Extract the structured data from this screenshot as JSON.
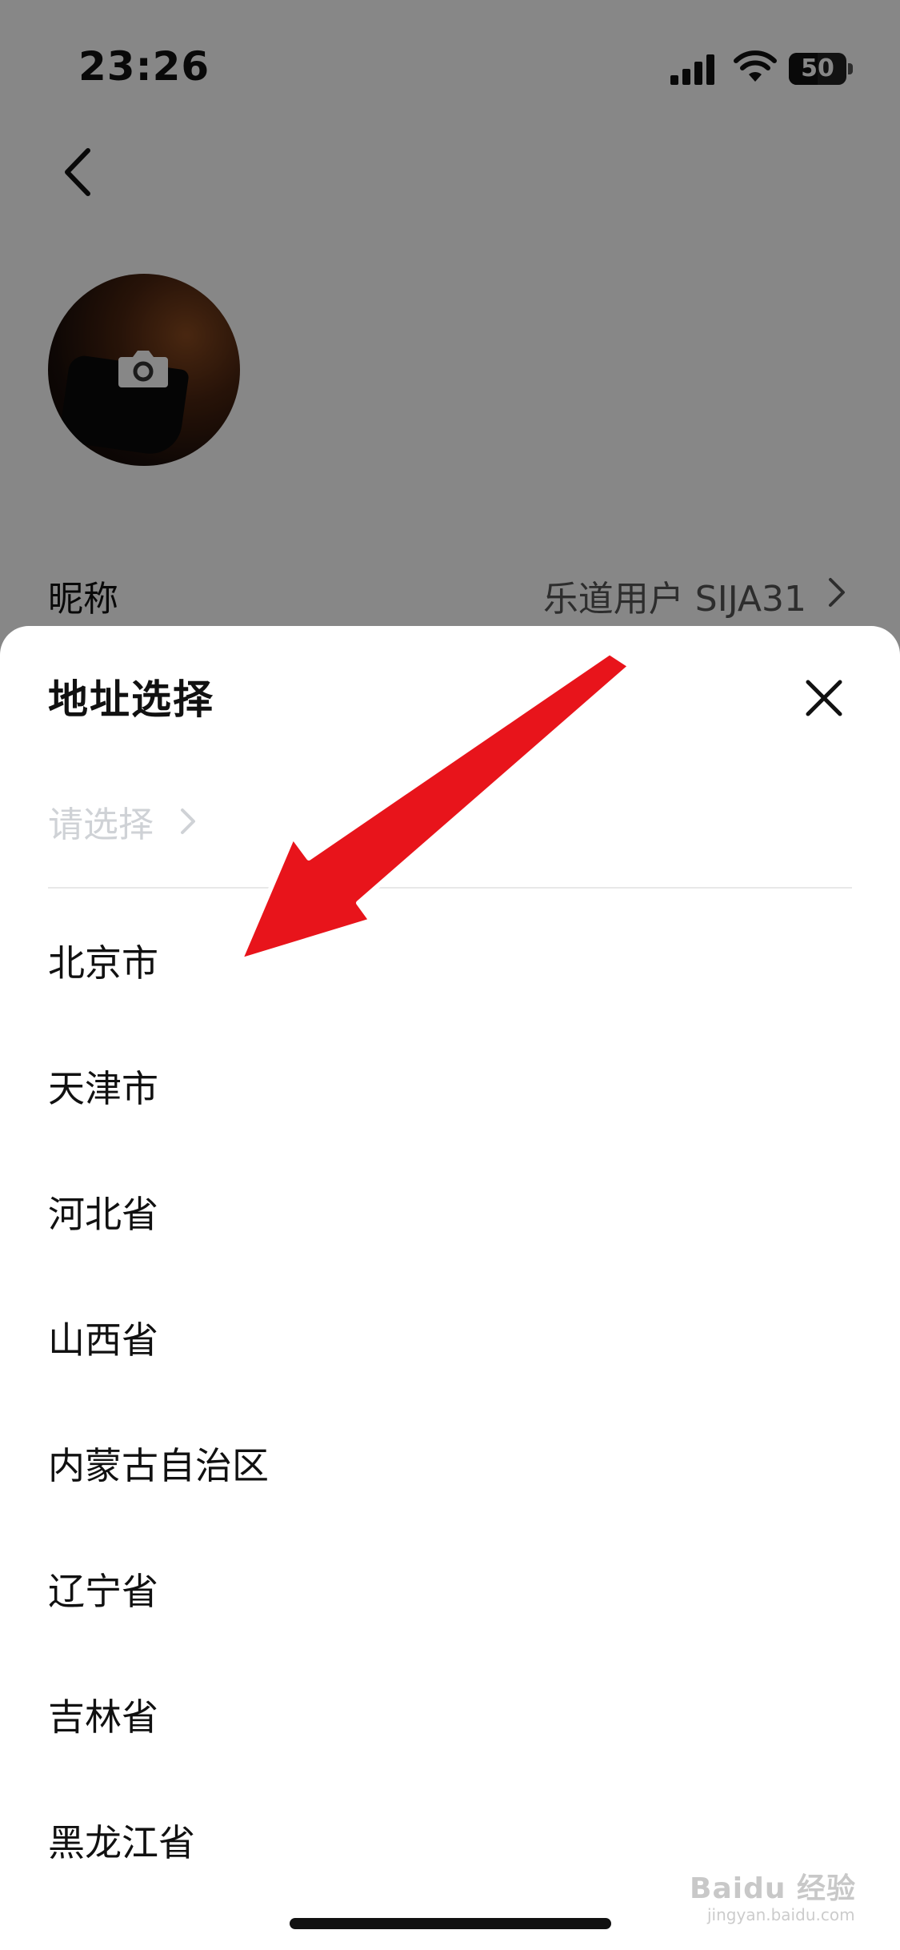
{
  "status_bar": {
    "time": "23:26",
    "battery_level": "50"
  },
  "profile": {
    "nickname_label": "昵称",
    "nickname_value": "乐道用户 SIJA31"
  },
  "sheet": {
    "title": "地址选择",
    "placeholder": "请选择",
    "regions": [
      "北京市",
      "天津市",
      "河北省",
      "山西省",
      "内蒙古自治区",
      "辽宁省",
      "吉林省",
      "黑龙江省"
    ]
  },
  "watermark": {
    "text": "Baidu 经验",
    "sub": "jingyan.baidu.com"
  },
  "colors": {
    "annotation_arrow": "#e8141b",
    "placeholder": "#cfd2d6",
    "overlay": "rgba(0,0,0,0.47)"
  },
  "icons": [
    "back-icon",
    "camera-icon",
    "chevron-right-icon",
    "close-icon",
    "signal-icon",
    "wifi-icon",
    "battery-icon"
  ]
}
